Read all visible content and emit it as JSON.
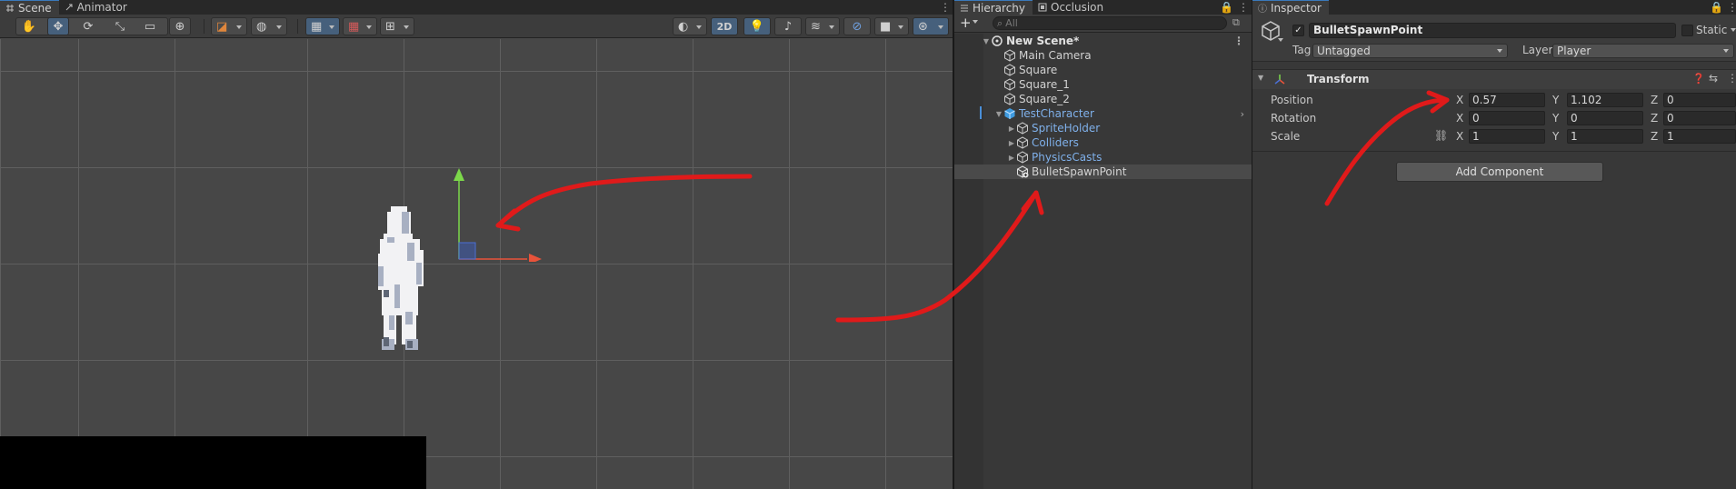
{
  "scene_panel": {
    "tabs": [
      {
        "label": "Scene",
        "icon": "hash-icon",
        "active": true
      },
      {
        "label": "Animator",
        "icon": "animator-icon",
        "active": false
      }
    ],
    "toolbar": {
      "tools": [
        "hand-tool-icon",
        "move-tool-icon",
        "rotate-tool-icon",
        "scale-tool-icon",
        "rect-tool-icon",
        "transform-tool-icon"
      ],
      "btn_2d": "2D"
    }
  },
  "hierarchy": {
    "tabs": [
      {
        "label": "Hierarchy",
        "icon": "list-icon",
        "active": true
      },
      {
        "label": "Occlusion",
        "icon": "occlusion-icon",
        "active": false
      }
    ],
    "add_label": "+",
    "search_placeholder": "All",
    "tree": [
      {
        "label": "New Scene*",
        "depth": 0,
        "kind": "scene",
        "expanded": true
      },
      {
        "label": "Main Camera",
        "depth": 1,
        "kind": "gameobject"
      },
      {
        "label": "Square",
        "depth": 1,
        "kind": "gameobject"
      },
      {
        "label": "Square_1",
        "depth": 1,
        "kind": "gameobject"
      },
      {
        "label": "Square_2",
        "depth": 1,
        "kind": "gameobject"
      },
      {
        "label": "TestCharacter",
        "depth": 1,
        "kind": "prefab",
        "expanded": true
      },
      {
        "label": "SpriteHolder",
        "depth": 2,
        "kind": "prefab-child",
        "collapsed": true
      },
      {
        "label": "Colliders",
        "depth": 2,
        "kind": "prefab-child",
        "collapsed": true
      },
      {
        "label": "PhysicsCasts",
        "depth": 2,
        "kind": "prefab-child",
        "collapsed": true
      },
      {
        "label": "BulletSpawnPoint",
        "depth": 2,
        "kind": "gameobject-added",
        "selected": true
      }
    ]
  },
  "inspector": {
    "tab_label": "Inspector",
    "object_name": "BulletSpawnPoint",
    "active_checked": true,
    "static_label": "Static",
    "tag_label": "Tag",
    "tag_value": "Untagged",
    "layer_label": "Layer",
    "layer_value": "Player",
    "component": {
      "title": "Transform",
      "rows": [
        {
          "label": "Position",
          "x": "0.57",
          "y": "1.102",
          "z": "0"
        },
        {
          "label": "Rotation",
          "x": "0",
          "y": "0",
          "z": "0"
        },
        {
          "label": "Scale",
          "x": "1",
          "y": "1",
          "z": "1"
        }
      ],
      "axis_x": "X",
      "axis_y": "Y",
      "axis_z": "Z"
    },
    "add_component_label": "Add Component"
  },
  "colors": {
    "arrow_red": "#e01a1a",
    "gizmo_green": "#7cd84a",
    "gizmo_red": "#e8533a",
    "gizmo_blue": "#4a6fd4",
    "prefab_blue": "#7fb0ea"
  }
}
